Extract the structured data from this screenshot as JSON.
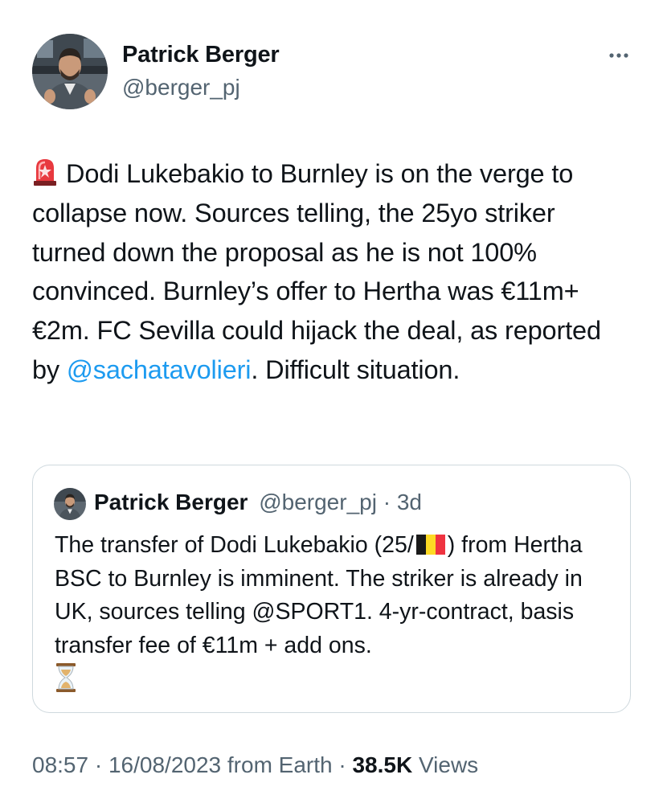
{
  "author": {
    "name": "Patrick Berger",
    "handle": "@berger_pj"
  },
  "more_label": "More",
  "tweet": {
    "emoji": "siren-icon",
    "text_before_link": "Dodi Lukebakio to Burnley is on the verge to collapse now. Sources telling, the 25yo striker turned down the proposal as he is not 100% convinced. Burnley’s offer to Hertha was €11m+€2m. FC Sevilla could hijack the deal, as reported by ",
    "mention": "@sachatavolieri",
    "text_after_link": ". Difficult situation."
  },
  "quoted": {
    "name": "Patrick Berger",
    "handle": "@berger_pj",
    "separator": "·",
    "age": "3d",
    "text_before_flag": "The transfer of Dodi Lukebakio (25/",
    "flag": "belgium-flag-icon",
    "text_after_flag": ") from Hertha BSC to Burnley is imminent. The striker is already in UK, sources telling @SPORT1. 4-yr-contract, basis transfer fee of €11m + add ons.",
    "trailing_emoji": "hourglass-icon"
  },
  "footer": {
    "time": "08:57",
    "sep1": "·",
    "date": "16/08/2023",
    "source": "from Earth",
    "sep2": "·",
    "views_count": "38.5K",
    "views_label": "Views"
  },
  "colors": {
    "link": "#1d9bf0",
    "secondary_text": "#536471",
    "primary_text": "#0f1419",
    "border": "#cfd9de"
  }
}
